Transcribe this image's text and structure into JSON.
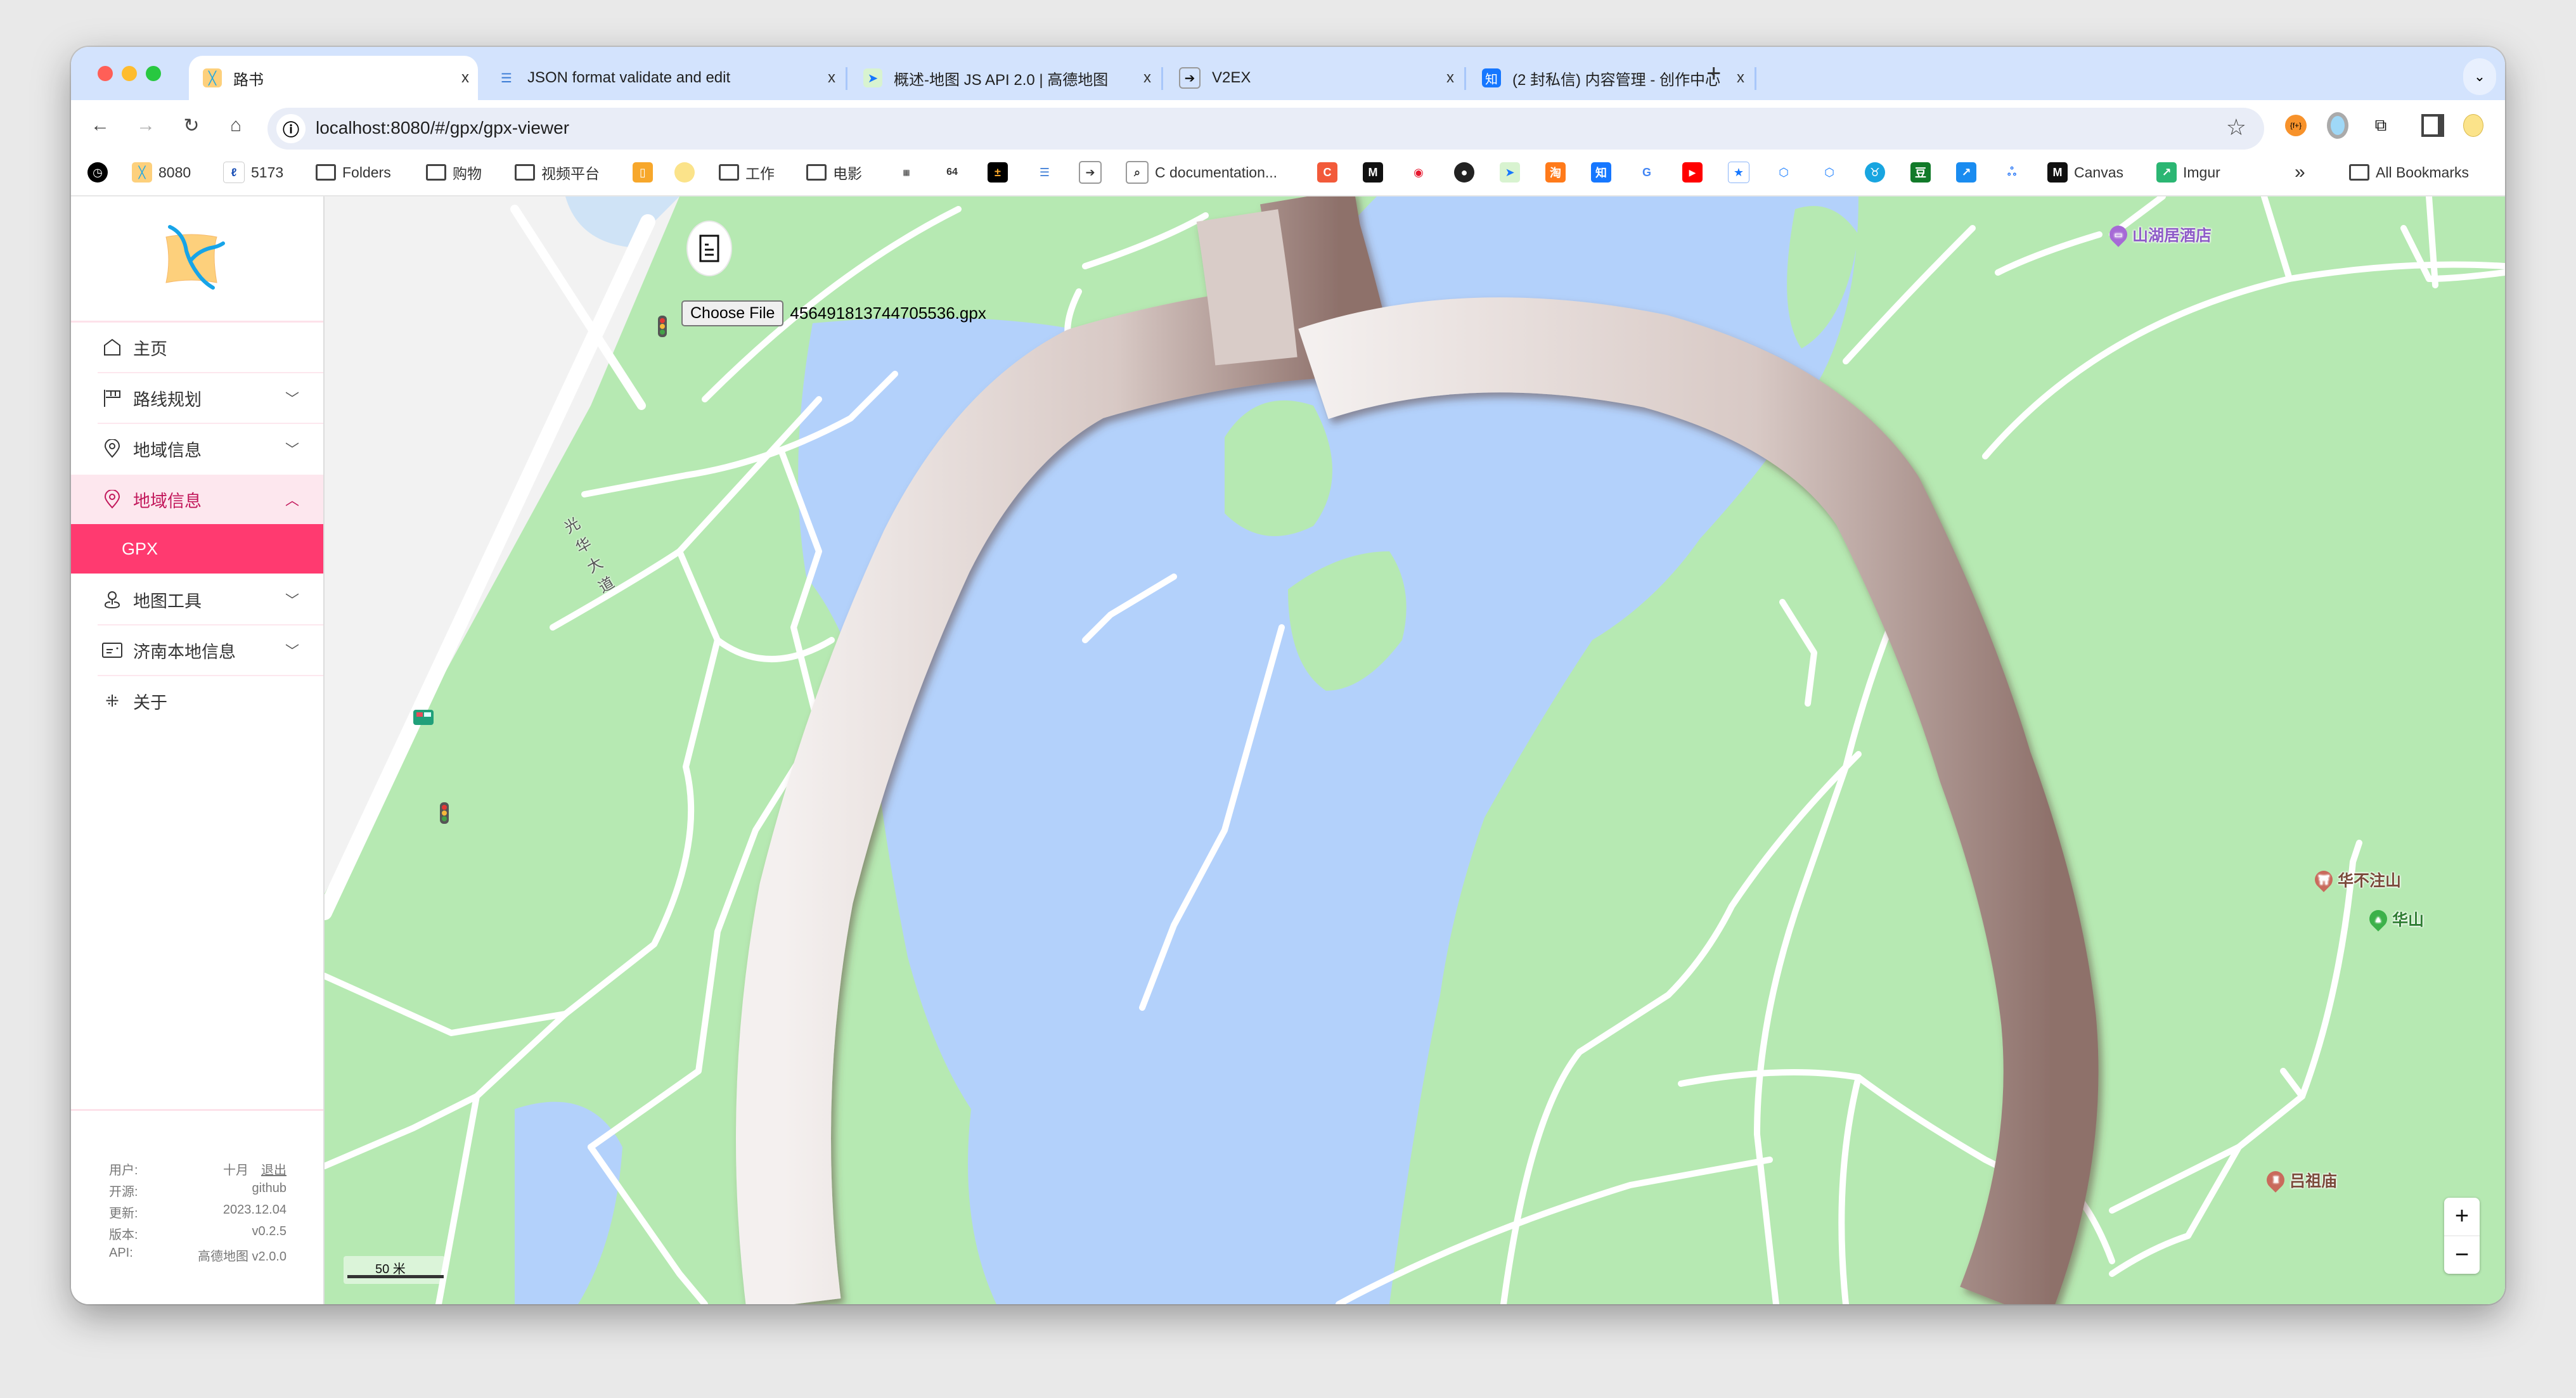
{
  "browser": {
    "tabs": [
      {
        "title": "路书",
        "active": true,
        "favicon": "map-icon"
      },
      {
        "title": "JSON format validate and edit",
        "active": false,
        "favicon": "json-lines-icon"
      },
      {
        "title": "概述-地图 JS API 2.0 | 高德地图",
        "active": false,
        "favicon": "amap-icon"
      },
      {
        "title": "V2EX",
        "active": false,
        "favicon": "v2ex-icon"
      },
      {
        "title": "(2 封私信) 内容管理 - 创作中心",
        "active": false,
        "favicon": "zhihu-icon"
      }
    ],
    "close_glyph": "x",
    "new_tab_glyph": "+",
    "tab_menu_glyph": "⌄",
    "url": "localhost:8080/#/gpx/gpx-viewer",
    "bookmarks": [
      {
        "label": "",
        "icon": "clock-icon"
      },
      {
        "label": "8080",
        "icon": "map-icon"
      },
      {
        "label": "5173",
        "icon": "vite-icon"
      },
      {
        "label": "Folders",
        "icon": "folder-icon"
      },
      {
        "label": "购物",
        "icon": "folder-icon"
      },
      {
        "label": "视频平台",
        "icon": "folder-icon"
      },
      {
        "label": "",
        "icon": "book-icon"
      },
      {
        "label": "",
        "icon": "chick-icon"
      },
      {
        "label": "工作",
        "icon": "folder-icon"
      },
      {
        "label": "电影",
        "icon": "folder-icon"
      },
      {
        "label": "",
        "icon": "json-grid-icon"
      },
      {
        "label": "",
        "icon": "base64-icon"
      },
      {
        "label": "",
        "icon": "calculator-icon"
      },
      {
        "label": "",
        "icon": "json-lines-icon"
      },
      {
        "label": "",
        "icon": "v2ex-icon"
      },
      {
        "label": "C documentation...",
        "icon": "search-doc-icon"
      },
      {
        "label": "",
        "icon": "c-icon"
      },
      {
        "label": "",
        "icon": "medium-icon"
      },
      {
        "label": "",
        "icon": "weibo-icon"
      },
      {
        "label": "",
        "icon": "github-icon"
      },
      {
        "label": "",
        "icon": "amap-icon"
      },
      {
        "label": "",
        "icon": "taobao-icon"
      },
      {
        "label": "",
        "icon": "zhihu-icon"
      },
      {
        "label": "",
        "icon": "google-icon"
      },
      {
        "label": "",
        "icon": "youtube-icon"
      },
      {
        "label": "",
        "icon": "star-icon"
      },
      {
        "label": "",
        "icon": "juejin-icon"
      },
      {
        "label": "",
        "icon": "juejin-plus-icon"
      },
      {
        "label": "",
        "icon": "bull-icon"
      },
      {
        "label": "",
        "icon": "douban-icon"
      },
      {
        "label": "",
        "icon": "chart-icon"
      },
      {
        "label": "",
        "icon": "baidu-cloud-icon"
      },
      {
        "label": "Canvas",
        "icon": "medium-icon"
      },
      {
        "label": "Imgur",
        "icon": "imgur-icon"
      }
    ],
    "more_bookmarks_glyph": "»",
    "all_bookmarks_label": "All Bookmarks"
  },
  "sidebar": {
    "menu": [
      {
        "label": "主页",
        "icon": "home-icon",
        "chevron": ""
      },
      {
        "label": "路线规划",
        "icon": "flag-icon",
        "chevron": "﹀"
      },
      {
        "label": "地域信息",
        "icon": "location-pin-icon",
        "chevron": "﹀"
      },
      {
        "label": "地域信息",
        "icon": "location-pin-icon",
        "chevron": "︿",
        "open": true
      },
      {
        "label": "GPX",
        "sub": true,
        "active": true
      },
      {
        "label": "地图工具",
        "icon": "map-user-icon",
        "chevron": "﹀"
      },
      {
        "label": "济南本地信息",
        "icon": "id-card-icon",
        "chevron": "﹀"
      },
      {
        "label": "关于",
        "icon": "sparkle-icon",
        "chevron": ""
      }
    ],
    "footer": [
      {
        "key": "用户:",
        "value": "十月",
        "link": "退出"
      },
      {
        "key": "开源:",
        "value": "github"
      },
      {
        "key": "更新:",
        "value": "2023.12.04"
      },
      {
        "key": "版本:",
        "value": "v0.2.5"
      },
      {
        "key": "API:",
        "value": "高德地图 v2.0.0"
      }
    ]
  },
  "map": {
    "file_button": "Choose File",
    "file_name": "456491813744705536.gpx",
    "road_label": "光华大道",
    "pois": [
      {
        "name": "山湖居酒店",
        "type": "hotel",
        "color": "#8e5cc7"
      },
      {
        "name": "华不注山",
        "type": "scenic-gate",
        "color": "#7a4a3a"
      },
      {
        "name": "华山",
        "type": "mountain",
        "color": "#2e7d32"
      },
      {
        "name": "吕祖庙",
        "type": "temple",
        "color": "#7a4a3a"
      }
    ],
    "scale_label": "50 米",
    "zoom_in": "+",
    "zoom_out": "−",
    "colors": {
      "land": "#b6e9b2",
      "water": "#b3d1fb",
      "road": "#ffffff",
      "track": "#c9b8b3",
      "accent": "#ff3a70"
    }
  }
}
